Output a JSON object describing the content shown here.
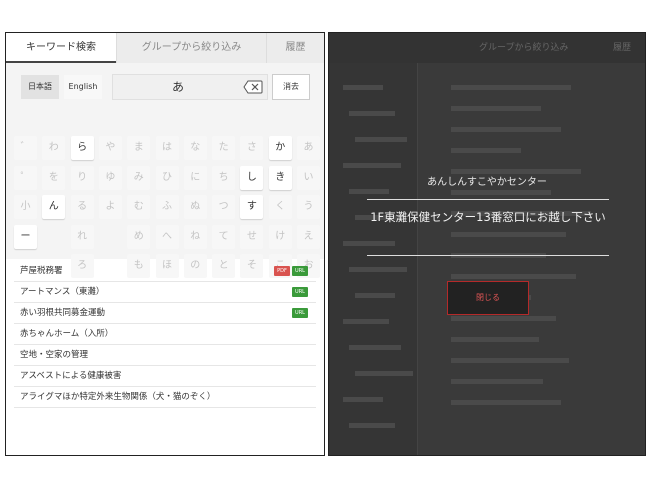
{
  "search_screen": {
    "tabs": [
      "キーワード検索",
      "グループから絞り込み",
      "履歴"
    ],
    "lang": {
      "japanese": "日本語",
      "english": "English"
    },
    "query": "あ",
    "clear_label": "消去",
    "keys": [
      [
        "゛",
        "わ",
        "ら",
        "や",
        "ま",
        "は",
        "な",
        "た",
        "さ",
        "か",
        "あ"
      ],
      [
        "゜",
        "を",
        "り",
        "ゆ",
        "み",
        "ひ",
        "に",
        "ち",
        "し",
        "き",
        "い"
      ],
      [
        "小",
        "ん",
        "る",
        "よ",
        "む",
        "ふ",
        "ぬ",
        "つ",
        "す",
        "く",
        "う"
      ],
      [
        "ー",
        "",
        "れ",
        "",
        "め",
        "へ",
        "ね",
        "て",
        "せ",
        "け",
        "え"
      ],
      [
        "",
        "",
        "ろ",
        "",
        "も",
        "ほ",
        "の",
        "と",
        "そ",
        "こ",
        "お"
      ]
    ],
    "enabled_keys": [
      "ら",
      "か",
      "し",
      "き",
      "ん",
      "す",
      "ー"
    ],
    "results": [
      {
        "label": "芦屋税務署",
        "pdf": "PDF",
        "url": "URL"
      },
      {
        "label": "アートマンス（東灘）",
        "url": "URL"
      },
      {
        "label": "赤い羽根共同募金運動",
        "url": "URL"
      },
      {
        "label": "赤ちゃんホーム（入所）"
      },
      {
        "label": "空地・空家の管理"
      },
      {
        "label": "アスベストによる健康被害"
      },
      {
        "label": "アライグマほか特定外来生物関係（犬・猫のぞく）"
      }
    ]
  },
  "modal": {
    "title": "あんしんすこやかセンター",
    "message": "1F東灘保健センター13番窓口にお越し下さい",
    "close_label": "閉じる"
  },
  "background": {
    "tabs": [
      "グループから絞り込み",
      "履歴"
    ]
  },
  "colors": {
    "badge_pdf": "#d9534f",
    "badge_url": "#3a9a3a",
    "close_border": "#b42a2a",
    "overlay": "#3a3a3a"
  }
}
